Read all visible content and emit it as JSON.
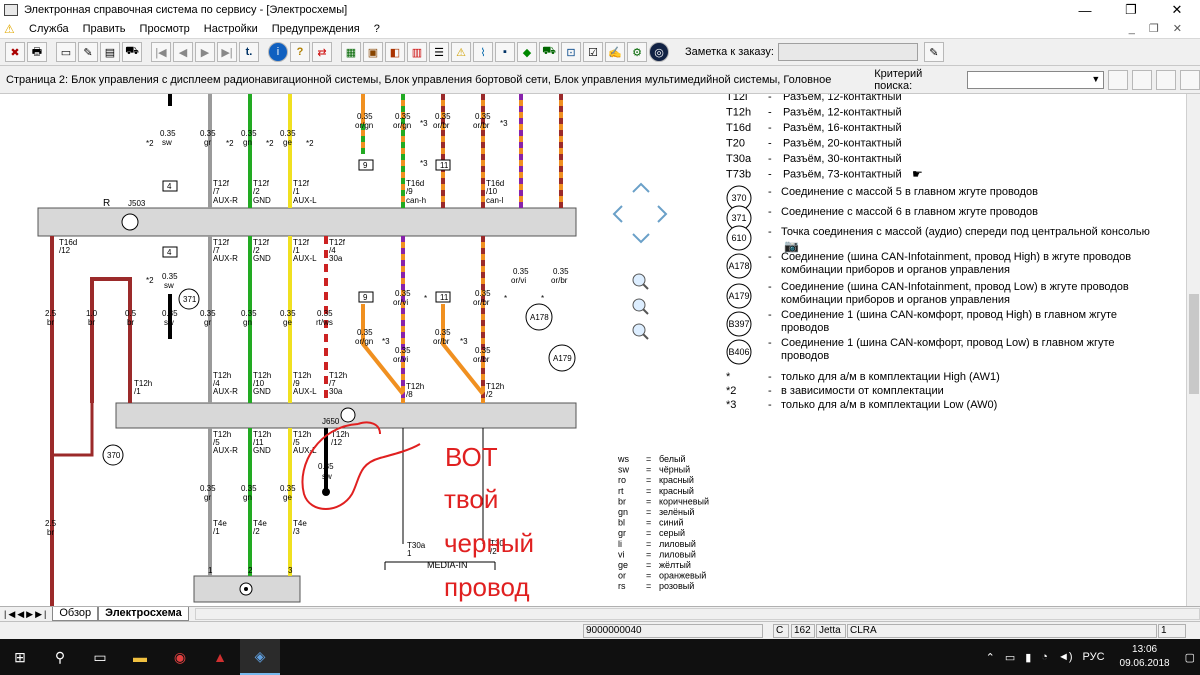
{
  "window": {
    "title": "Электронная справочная система по сервису - [Электросхемы]",
    "minimize": "—",
    "maximize": "❐",
    "close": "✕"
  },
  "menu": {
    "items": [
      "Служба",
      "Править",
      "Просмотр",
      "Настройки",
      "Предупреждения",
      "?"
    ],
    "mdi_controls": [
      "_",
      "❐",
      "✕"
    ]
  },
  "toolbar": {
    "note_label": "Заметка к заказу:",
    "note_value": ""
  },
  "pathbar": {
    "path": "Страница 2: Блок управления с дисплеем радионавигационной системы, Блок управления бортовой сети, Блок управления мультимедийной системы, Головное",
    "criterion_label": "Критерий поиска:",
    "criterion_value": ""
  },
  "legend_connectors": [
    {
      "code": "T12l",
      "desc": "Разъем, 12-контактный"
    },
    {
      "code": "T12h",
      "desc": "Разъём, 12-контактный"
    },
    {
      "code": "T16d",
      "desc": "Разъём, 16-контактный"
    },
    {
      "code": "T20",
      "desc": "Разъём, 20-контактный"
    },
    {
      "code": "T30a",
      "desc": "Разъём, 30-контактный"
    },
    {
      "code": "T73b",
      "desc": "Разъём, 73-контактный"
    }
  ],
  "legend_circles": [
    {
      "code": "370",
      "lines": [
        "Соединение с массой 5 в главном жгуте проводов"
      ]
    },
    {
      "code": "371",
      "lines": [
        "Соединение с массой 6 в главном жгуте проводов"
      ]
    },
    {
      "code": "610",
      "lines": [
        "Точка соединения с массой (аудио) спереди под центральной консолью"
      ]
    },
    {
      "code": "A178",
      "lines": [
        "Соединение (шина CAN-Infotainment, провод High) в жгуте проводов",
        "комбинации приборов и органов управления"
      ]
    },
    {
      "code": "A179",
      "lines": [
        "Соединение (шина CAN-Infotainment, провод Low) в жгуте проводов",
        "комбинации приборов и органов управления"
      ]
    },
    {
      "code": "B397",
      "lines": [
        "Соединение 1 (шина CAN-комфорт, провод High) в главном жгуте",
        "проводов"
      ]
    },
    {
      "code": "B406",
      "lines": [
        "Соединение 1 (шина CAN-комфорт, провод Low) в главном жгуте",
        "проводов"
      ]
    }
  ],
  "legend_notes": [
    {
      "mark": "*",
      "desc": "только для а/м в комплектации High (AW1)"
    },
    {
      "mark": "*2",
      "desc": "в зависимости от комплектации"
    },
    {
      "mark": "*3",
      "desc": "только для а/м в комплектации Low (AW0)"
    }
  ],
  "color_codes": [
    {
      "code": "ws",
      "name": "белый"
    },
    {
      "code": "sw",
      "name": "чёрный"
    },
    {
      "code": "ro",
      "name": "красный"
    },
    {
      "code": "rt",
      "name": "красный"
    },
    {
      "code": "br",
      "name": "коричневый"
    },
    {
      "code": "gn",
      "name": "зелёный"
    },
    {
      "code": "bl",
      "name": "синий"
    },
    {
      "code": "gr",
      "name": "серый"
    },
    {
      "code": "li",
      "name": "лиловый"
    },
    {
      "code": "vi",
      "name": "лиловый"
    },
    {
      "code": "ge",
      "name": "жёлтый"
    },
    {
      "code": "or",
      "name": "оранжевый"
    },
    {
      "code": "rs",
      "name": "розовый"
    }
  ],
  "annotation": {
    "lines": [
      "ВОТ",
      "твой",
      "черный",
      "провод"
    ],
    "color": "#e02020"
  },
  "diagram": {
    "top_block_label": "R",
    "top_block_id": "J503",
    "mid_block_id": "J650",
    "media_in": "MEDIA-IN",
    "t30a_label": "T30a",
    "t30a_pin": "1"
  },
  "wire_colors": {
    "gray": "#9a9a9a",
    "green": "#22aa22",
    "yellow": "#f0e020",
    "red": "#cc2222",
    "brown": "#9b2a2a",
    "orange": "#f09020",
    "violet": "#8822aa",
    "black": "#000000"
  },
  "tabs": [
    {
      "label": "Обзор",
      "active": false
    },
    {
      "label": "Электросхема",
      "active": true
    }
  ],
  "status": {
    "order_no": "9000000040",
    "c": "C",
    "num": "162",
    "model": "Jetta",
    "engine": "CLRA",
    "page": "1"
  },
  "tray": {
    "lang": "РУС",
    "time": "13:06",
    "date": "09.06.2018"
  }
}
